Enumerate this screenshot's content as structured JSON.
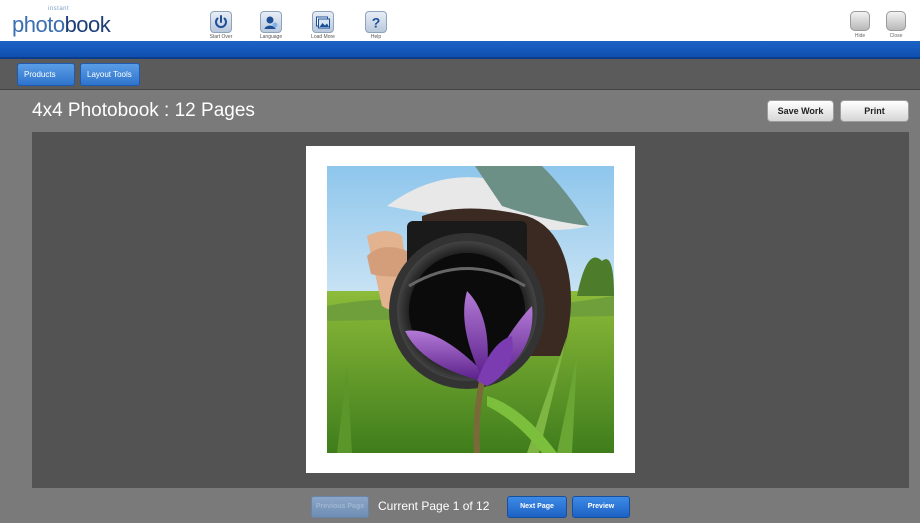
{
  "app": {
    "logo_small": "instant",
    "logo_part1": "photo",
    "logo_part2": "book"
  },
  "toolbar": {
    "items": [
      {
        "label": "Start Over",
        "icon": "power-icon"
      },
      {
        "label": "Language",
        "icon": "user-icon"
      },
      {
        "label": "Load More",
        "icon": "photos-icon"
      },
      {
        "label": "Help",
        "icon": "question-icon"
      }
    ],
    "right_items": [
      {
        "label": "Hide"
      },
      {
        "label": "Close"
      }
    ]
  },
  "tabs": [
    {
      "label": "Products"
    },
    {
      "label": "Layout Tools"
    }
  ],
  "page": {
    "title": "4x4 Photobook : 12 Pages",
    "save_label": "Save Work",
    "print_label": "Print"
  },
  "pager": {
    "prev_label": "Previous Page",
    "status": "Current Page 1 of 12",
    "next_label": "Next Page",
    "preview_label": "Preview"
  },
  "colors": {
    "accent": "#1b63c6",
    "background": "#7a7a7a",
    "stage": "#535353"
  }
}
